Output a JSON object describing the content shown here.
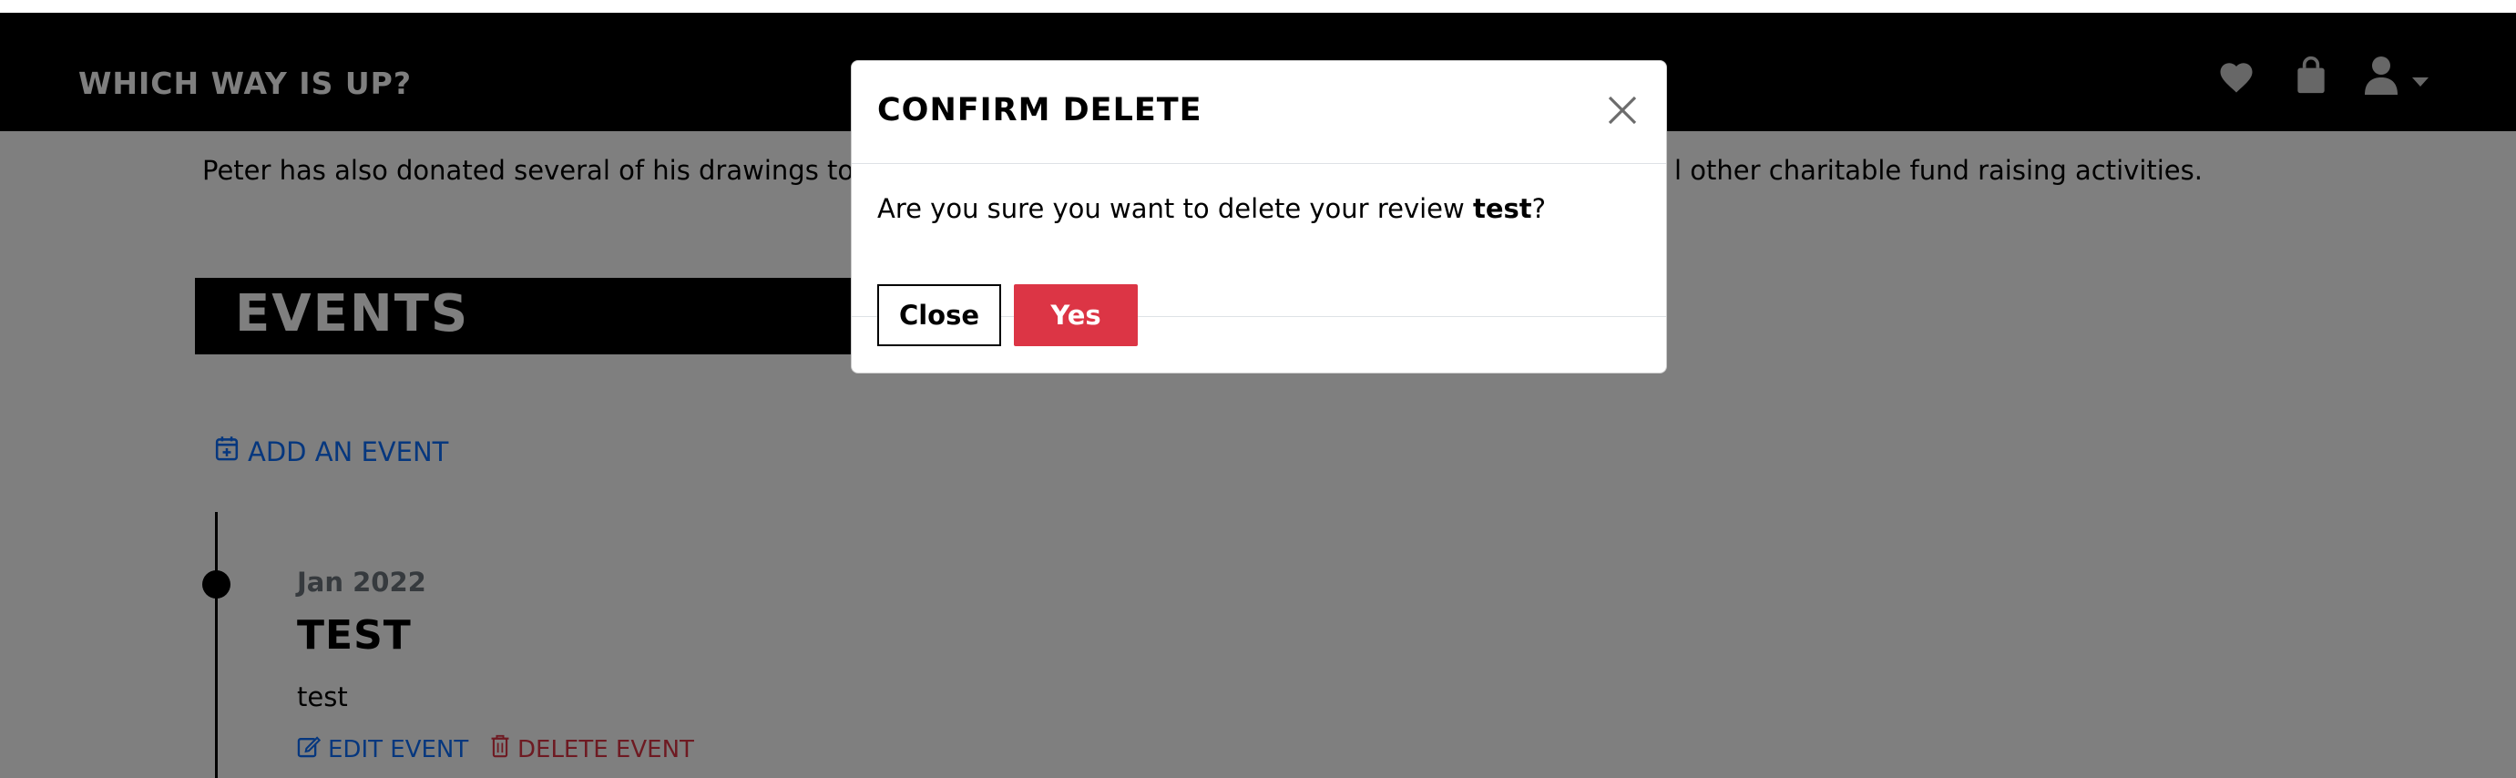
{
  "navbar": {
    "brand": "WHICH WAY IS UP?",
    "icons": [
      "heart-icon",
      "shopping-bag-icon",
      "user-icon",
      "caret-down-icon"
    ]
  },
  "page": {
    "paragraph_left": "Peter has also donated several of his drawings to loca",
    "paragraph_right": "l other charitable fund raising activities.",
    "events_heading": "EVENTS",
    "add_event_label": "ADD AN EVENT",
    "event": {
      "date": "Jan 2022",
      "title": "TEST",
      "description": "test",
      "edit_label": "EDIT EVENT",
      "delete_label": "DELETE EVENT"
    }
  },
  "modal": {
    "title": "CONFIRM DELETE",
    "message_prefix": "Are you sure you want to delete your review ",
    "message_item": "test",
    "message_suffix": "?",
    "close_label": "Close",
    "yes_label": "Yes"
  },
  "colors": {
    "danger": "#dc3545",
    "link": "#0d6efd",
    "navbar_bg": "#000000"
  }
}
